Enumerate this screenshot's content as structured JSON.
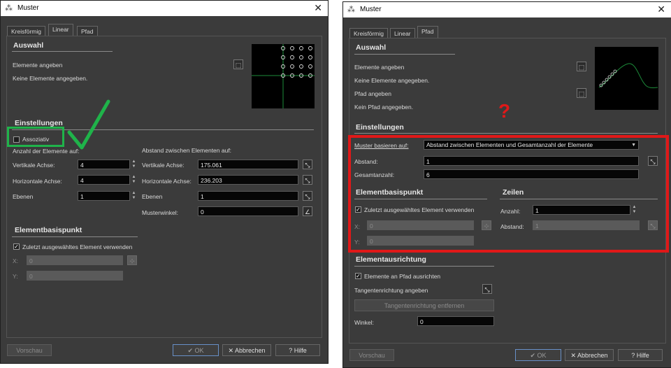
{
  "window_title": "Muster",
  "tabs": [
    "Kreisförmig",
    "Linear",
    "Pfad"
  ],
  "left": {
    "auswahl": {
      "title": "Auswahl",
      "elemente_angeben": "Elemente angeben",
      "keine_elemente": "Keine Elemente angegeben."
    },
    "einstellungen": {
      "title": "Einstellungen",
      "assoziativ": "Assoziativ",
      "anzahl_label": "Anzahl der Elemente auf:",
      "abstand_label": "Abstand zwischen Elementen auf:",
      "vertikale_achse": "Vertikale Achse:",
      "horizontale_achse": "Horizontale Achse:",
      "ebenen": "Ebenen",
      "musterwinkel": "Musterwinkel:",
      "count_vertikal": "4",
      "count_horizontal": "4",
      "count_ebenen": "1",
      "dist_vertikal": "175.061",
      "dist_horizontal": "236.203",
      "dist_ebenen": "1",
      "winkel": "0"
    },
    "basispunkt": {
      "title": "Elementbasispunkt",
      "zuletzt": "Zuletzt ausgewähltes Element verwenden",
      "x": "X:",
      "y": "Y:",
      "x_val": "0",
      "y_val": "0"
    },
    "buttons": {
      "vorschau": "Vorschau",
      "ok": "OK",
      "abbrechen": "Abbrechen",
      "hilfe": "Hilfe"
    }
  },
  "right": {
    "auswahl": {
      "title": "Auswahl",
      "elemente_angeben": "Elemente angeben",
      "keine_elemente": "Keine Elemente angegeben.",
      "pfad_angeben": "Pfad angeben",
      "kein_pfad": "Kein Pfad angegeben."
    },
    "question_mark": "?",
    "einstellungen": {
      "title": "Einstellungen",
      "muster_basieren": "Muster basieren auf:",
      "muster_value": "Abstand zwischen Elementen und Gesamtanzahl der Elemente",
      "abstand": "Abstand:",
      "abstand_val": "1",
      "gesamtanzahl": "Gesamtanzahl:",
      "gesamtanzahl_val": "6"
    },
    "basispunkt": {
      "title": "Elementbasispunkt",
      "zuletzt": "Zuletzt ausgewähltes Element verwenden",
      "x": "X:",
      "y": "Y:",
      "x_val": "0",
      "y_val": "0"
    },
    "zeilen": {
      "title": "Zeilen",
      "anzahl": "Anzahl:",
      "anzahl_val": "1",
      "abstand": "Abstand:",
      "abstand_val": "1"
    },
    "ausrichtung": {
      "title": "Elementausrichtung",
      "an_pfad": "Elemente an Pfad ausrichten",
      "tangenten": "Tangentenrichtung angeben",
      "entfernen": "Tangentenrichtung entfernen",
      "winkel": "Winkel:",
      "winkel_val": "0"
    },
    "buttons": {
      "vorschau": "Vorschau",
      "ok": "OK",
      "abbrechen": "Abbrechen",
      "hilfe": "Hilfe"
    }
  },
  "colors": {
    "annotation_green": "#1fb34a",
    "annotation_red": "#e01818",
    "preview_green": "#1c8c3a"
  }
}
